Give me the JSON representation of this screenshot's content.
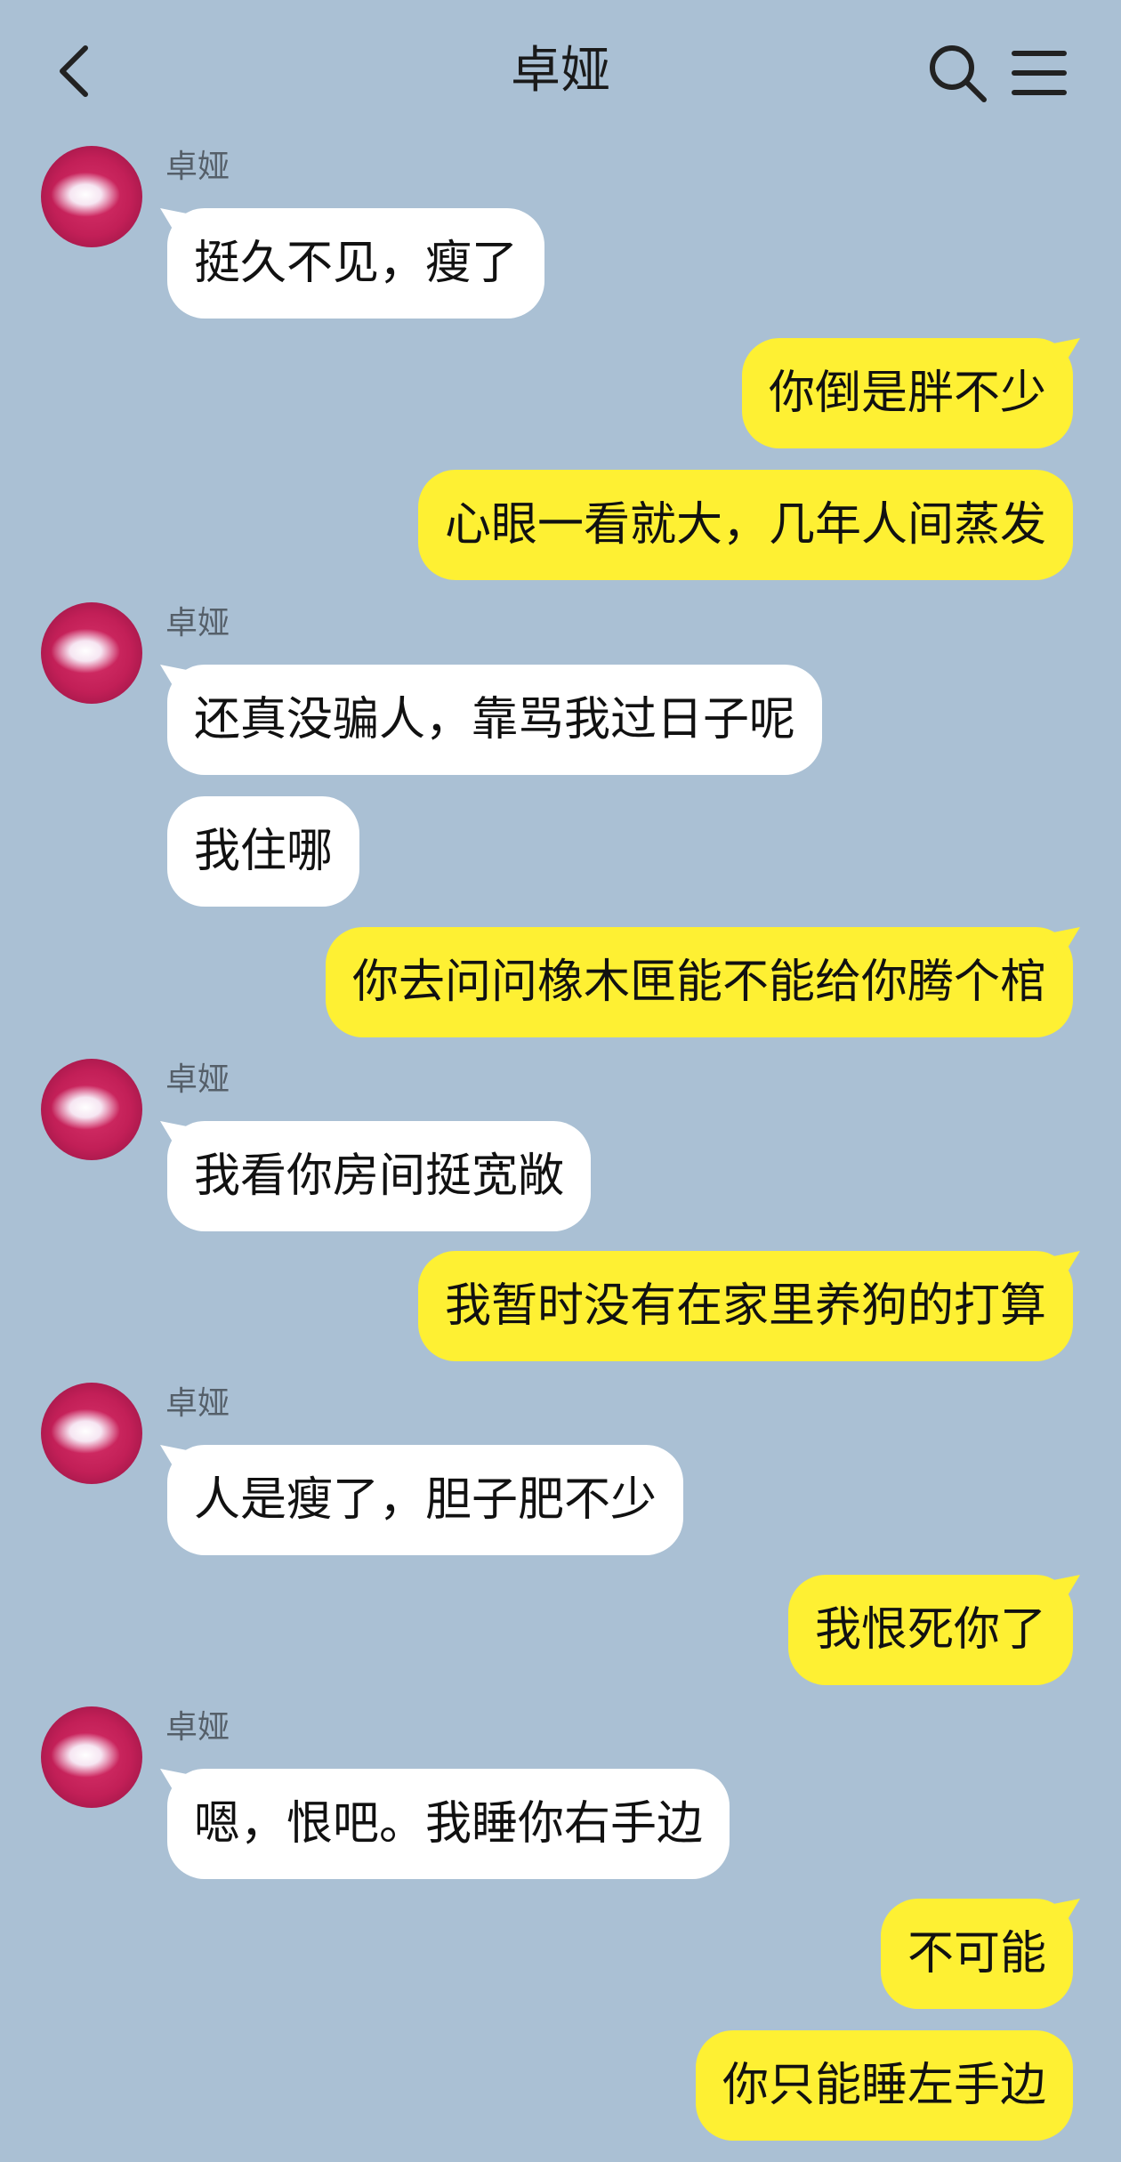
{
  "header": {
    "title": "卓娅"
  },
  "contact_name": "卓娅",
  "messages": [
    {
      "from": "them",
      "text": "挺久不见，瘦了"
    },
    {
      "from": "me",
      "text": "你倒是胖不少"
    },
    {
      "from": "me",
      "text": "心眼一看就大，几年人间蒸发"
    },
    {
      "from": "them",
      "text": "还真没骗人，靠骂我过日子呢"
    },
    {
      "from": "them",
      "text": "我住哪"
    },
    {
      "from": "me",
      "text": "你去问问橡木匣能不能给你腾个棺"
    },
    {
      "from": "them",
      "text": "我看你房间挺宽敞"
    },
    {
      "from": "me",
      "text": "我暂时没有在家里养狗的打算"
    },
    {
      "from": "them",
      "text": "人是瘦了，胆子肥不少"
    },
    {
      "from": "me",
      "text": "我恨死你了"
    },
    {
      "from": "them",
      "text": "嗯，恨吧。我睡你右手边"
    },
    {
      "from": "me",
      "text": "不可能"
    },
    {
      "from": "me",
      "text": "你只能睡左手边"
    }
  ],
  "colors": {
    "background": "#aac0d4",
    "incoming_bubble": "#ffffff",
    "outgoing_bubble": "#fef033"
  }
}
